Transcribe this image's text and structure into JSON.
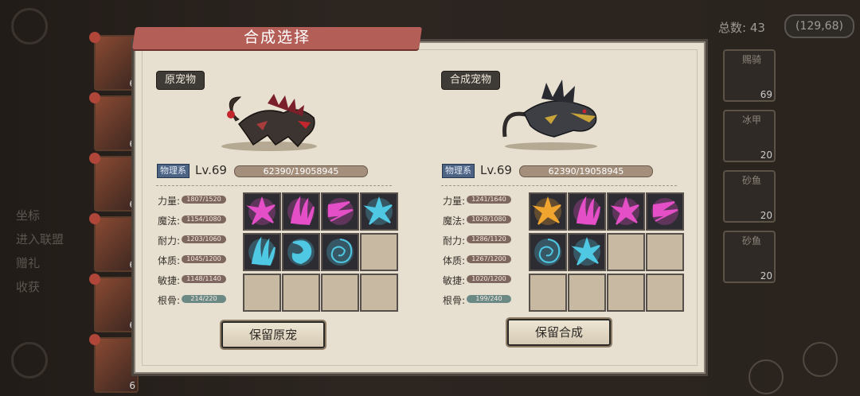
{
  "title": "合成选择",
  "background": {
    "total_label": "总数: 43",
    "coords": "(129,68)",
    "left_levels": [
      "6",
      "6",
      "6",
      "6",
      "6",
      "6"
    ],
    "left_texts": [
      "坐标",
      "进入联盟",
      "赠礼",
      "收获"
    ],
    "right_cards": [
      {
        "name": "赐骑",
        "level": "69"
      },
      {
        "name": "冰甲",
        "level": "20"
      },
      {
        "name": "砂鱼",
        "level": "20"
      },
      {
        "name": "砂鱼",
        "level": "20"
      }
    ]
  },
  "left": {
    "tag": "原宠物",
    "type": "物理系",
    "level": "Lv.69",
    "exp": "62390/19058945",
    "stats": [
      {
        "label": "力量:",
        "value": "1807/1520"
      },
      {
        "label": "魔法:",
        "value": "1154/1080"
      },
      {
        "label": "耐力:",
        "value": "1203/1060"
      },
      {
        "label": "体质:",
        "value": "1045/1200"
      },
      {
        "label": "敏捷:",
        "value": "1148/1140"
      },
      {
        "label": "根骨:",
        "value": "214/220"
      }
    ],
    "skills": [
      {
        "icon": "magenta-burst-icon",
        "color": "#e44fc7"
      },
      {
        "icon": "magenta-claw-icon",
        "color": "#e44fc7"
      },
      {
        "icon": "magenta-slash-icon",
        "color": "#e44fc7"
      },
      {
        "icon": "cyan-burst-icon",
        "color": "#4fc8e4"
      },
      {
        "icon": "cyan-claw-icon",
        "color": "#4fc8e4"
      },
      {
        "icon": "cyan-rune-icon",
        "color": "#4fc8e4"
      },
      {
        "icon": "cyan-swirl-icon",
        "color": "#4fc8e4"
      }
    ],
    "button": "保留原宠"
  },
  "right": {
    "tag": "合成宠物",
    "type": "物理系",
    "level": "Lv.69",
    "exp": "62390/19058945",
    "stats": [
      {
        "label": "力量:",
        "value": "1241/1640"
      },
      {
        "label": "魔法:",
        "value": "1028/1080"
      },
      {
        "label": "耐力:",
        "value": "1286/1120"
      },
      {
        "label": "体质:",
        "value": "1267/1200"
      },
      {
        "label": "敏捷:",
        "value": "1020/1200"
      },
      {
        "label": "根骨:",
        "value": "199/240"
      }
    ],
    "skills": [
      {
        "icon": "gold-burst-icon",
        "color": "#f0a52e"
      },
      {
        "icon": "magenta-claw-icon",
        "color": "#e44fc7"
      },
      {
        "icon": "magenta-burst-icon",
        "color": "#e44fc7"
      },
      {
        "icon": "magenta-slash-icon",
        "color": "#e44fc7"
      },
      {
        "icon": "cyan-swirl-icon",
        "color": "#4fc8e4"
      },
      {
        "icon": "cyan-burst-icon",
        "color": "#4fc8e4"
      }
    ],
    "button": "保留合成"
  }
}
